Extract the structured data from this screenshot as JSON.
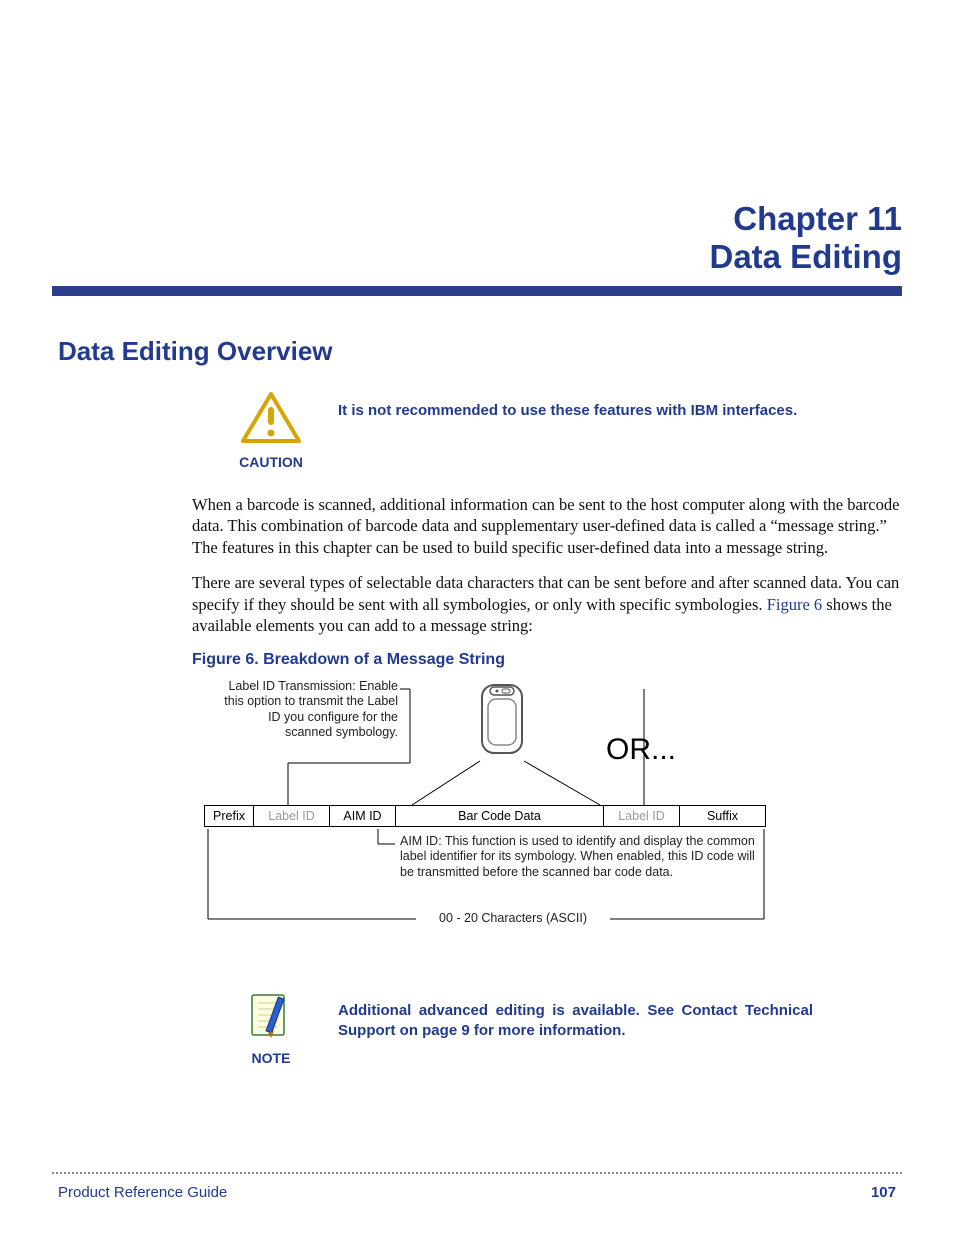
{
  "chapter": {
    "number": "Chapter 11",
    "title": "Data Editing"
  },
  "section": {
    "heading": "Data Editing Overview"
  },
  "caution": {
    "label": "CAUTION",
    "message": "It is not recommended to use these features with IBM interfaces."
  },
  "paragraphs": {
    "p1": "When a barcode is scanned, additional information can be sent to the host computer along with the barcode data. This combination of barcode data and supplementary user-defined data is called a “message string.” The features in this chapter can be used to build specific user-defined data into a message string.",
    "p2a": "There are several types of selectable data characters that can be sent before and after scanned data. You can specify if they should be sent with all symbologies, or only with specific symbologies. ",
    "p2link": "Figure 6",
    "p2b": " shows the available elements you can add to a message string:"
  },
  "figure": {
    "caption": "Figure 6. Breakdown of a Message String",
    "label_id_annot": "Label ID Transmission: Enable this option to transmit the Label ID you configure for the scanned symbology.",
    "or": "OR...",
    "cells": {
      "prefix": "Prefix",
      "label_id_left": "Label ID",
      "aim_id": "AIM ID",
      "bar_code_data": "Bar Code Data",
      "label_id_right": "Label ID",
      "suffix": "Suffix"
    },
    "aim_annot": "AIM ID: This function is used to identify and display the common label identifier for its symbology. When enabled, this ID code will be transmitted before the scanned bar code data.",
    "range": "00 - 20 Characters (ASCII)"
  },
  "note": {
    "label": "NOTE",
    "message": "Additional advanced editing is available. See Contact Technical Support on page 9 for more information."
  },
  "footer": {
    "left": "Product Reference Guide",
    "page": "107"
  }
}
